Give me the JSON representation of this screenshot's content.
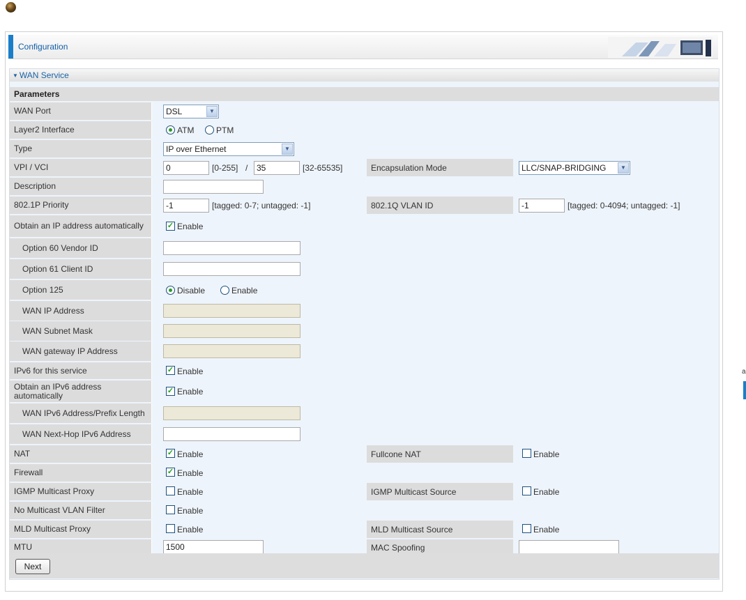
{
  "header": {
    "title": "Configuration"
  },
  "section": {
    "title": "WAN Service",
    "params_title": "Parameters"
  },
  "wan_port": {
    "label": "WAN Port",
    "value": "DSL"
  },
  "layer2": {
    "label": "Layer2 Interface",
    "opt1": "ATM",
    "opt2": "PTM",
    "selected": "ATM"
  },
  "type": {
    "label": "Type",
    "value": "IP over Ethernet"
  },
  "vpi": {
    "label": "VPI / VCI",
    "vpi_value": "0",
    "vpi_range": "[0-255]",
    "slash": "/",
    "vci_value": "35",
    "vci_range": "[32-65535]"
  },
  "encap": {
    "label": "Encapsulation Mode",
    "value": "LLC/SNAP-BRIDGING"
  },
  "description": {
    "label": "Description",
    "value": ""
  },
  "priority": {
    "label": "802.1P Priority",
    "value": "-1",
    "hint": "[tagged: 0-7; untagged: -1]"
  },
  "vlan": {
    "label": "802.1Q VLAN ID",
    "value": "-1",
    "hint": "[tagged: 0-4094; untagged: -1]"
  },
  "obtain_ip": {
    "label": "Obtain an IP address automatically",
    "option": "Enable",
    "checked": true
  },
  "option60": {
    "label": "Option 60 Vendor ID",
    "value": ""
  },
  "option61": {
    "label": "Option 61 Client ID",
    "value": ""
  },
  "option125": {
    "label": "Option 125",
    "opt1": "Disable",
    "opt2": "Enable",
    "selected": "Disable"
  },
  "wan_ip": {
    "label": "WAN IP Address",
    "value": ""
  },
  "wan_mask": {
    "label": "WAN Subnet Mask",
    "value": ""
  },
  "wan_gw": {
    "label": "WAN gateway IP Address",
    "value": ""
  },
  "ipv6": {
    "label": "IPv6 for this service",
    "option": "Enable",
    "checked": true
  },
  "obtain_ipv6": {
    "label": "Obtain an IPv6 address automatically",
    "option": "Enable",
    "checked": true
  },
  "ipv6_prefix": {
    "label": "WAN IPv6 Address/Prefix Length",
    "value": ""
  },
  "ipv6_nexthop": {
    "label": "WAN Next-Hop IPv6 Address",
    "value": ""
  },
  "nat": {
    "label": "NAT",
    "option": "Enable",
    "checked": true
  },
  "fullcone": {
    "label": "Fullcone NAT",
    "option": "Enable",
    "checked": false
  },
  "firewall": {
    "label": "Firewall",
    "option": "Enable",
    "checked": true
  },
  "igmp_proxy": {
    "label": "IGMP Multicast Proxy",
    "option": "Enable",
    "checked": false
  },
  "igmp_source": {
    "label": "IGMP Multicast Source",
    "option": "Enable",
    "checked": false
  },
  "no_mvlan": {
    "label": "No Multicast VLAN Filter",
    "option": "Enable",
    "checked": false
  },
  "mld_proxy": {
    "label": "MLD Multicast Proxy",
    "option": "Enable",
    "checked": false
  },
  "mld_source": {
    "label": "MLD Multicast Source",
    "option": "Enable",
    "checked": false
  },
  "mtu": {
    "label": "MTU",
    "value": "1500"
  },
  "mac_spoof": {
    "label": "MAC Spoofing",
    "value": ""
  },
  "actions": {
    "next_label": "Next"
  },
  "edge": {
    "char": "a"
  },
  "colors": {
    "accent": "#1a7ec9",
    "label_bg": "#dcdcdc",
    "row_bg": "#eef4fb",
    "check": "#21a121"
  }
}
